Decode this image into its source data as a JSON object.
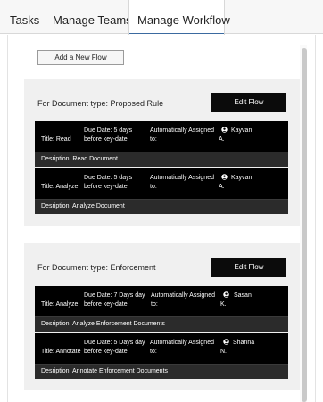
{
  "tabs": [
    {
      "label": "Tasks"
    },
    {
      "label": "Manage Teams"
    },
    {
      "label": "Manage Workflow"
    }
  ],
  "add_flow_label": "Add a New Flow",
  "groups": [
    {
      "title": "For Document type:  Proposed Rule",
      "edit_label": "Edit Flow",
      "flows": [
        {
          "title_line": "Title:  Read",
          "due_line1": "Due Date:  5 days",
          "due_line2": "before key-date",
          "assign_line1": "Automatically Assigned",
          "assign_line2": "to:",
          "assignee_line1": "Kayvan",
          "assignee_line2": "A.",
          "description_line": "Desription:  Read Document"
        },
        {
          "title_line": "Title:  Analyze",
          "due_line1": "Due Date:  5 days",
          "due_line2": "before key-date",
          "assign_line1": "Automatically Assigned",
          "assign_line2": "to:",
          "assignee_line1": "Kayvan",
          "assignee_line2": "A.",
          "description_line": "Desription:  Analyze Document"
        }
      ]
    },
    {
      "title": "For Document type:  Enforcement",
      "edit_label": "Edit Flow",
      "flows": [
        {
          "title_line": "Title:  Analyze",
          "due_line1": "Due Date:  7 Days day",
          "due_line2": "before key-date",
          "assign_line1": "Automatically Assigned",
          "assign_line2": "to:",
          "assignee_line1": "Sasan",
          "assignee_line2": "K.",
          "description_line": "Desription:  Analyze Enforcement Documents"
        },
        {
          "title_line": "Title:  Annotate",
          "due_line1": "Due Date:  5 Days day",
          "due_line2": "before key-date",
          "assign_line1": "Automatically Assigned",
          "assign_line2": "to:",
          "assignee_line1": "Shanna",
          "assignee_line2": "N.",
          "description_line": "Desription:  Annotate Enforcement Documents"
        }
      ]
    }
  ],
  "icons": {
    "assignee": "person-circle-icon"
  },
  "colors": {
    "accent": "#3b6aa0",
    "card_background": "#000000",
    "group_background": "#f0f0f0"
  }
}
